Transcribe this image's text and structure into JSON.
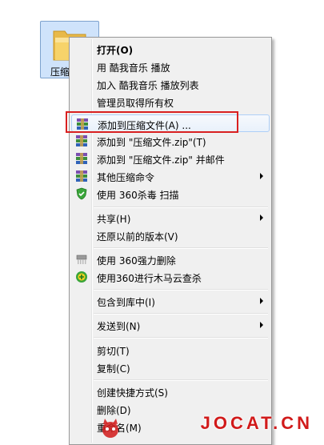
{
  "desktop": {
    "folder_label": "压缩"
  },
  "menu": {
    "items": [
      {
        "label": "打开(O)",
        "icon": "none"
      },
      {
        "label": "用 酷我音乐 播放",
        "icon": "none"
      },
      {
        "label": "加入 酷我音乐 播放列表",
        "icon": "none"
      },
      {
        "label": "管理员取得所有权",
        "icon": "none"
      },
      {
        "label": "添加到压缩文件(A) ...",
        "icon": "winrar-icon"
      },
      {
        "label": "添加到 \"压缩文件.zip\"(T)",
        "icon": "winrar-icon"
      },
      {
        "label": "添加到 \"压缩文件.zip\" 并邮件",
        "icon": "winrar-icon"
      },
      {
        "label": "其他压缩命令",
        "icon": "winrar-icon"
      },
      {
        "label": "使用 360杀毒 扫描",
        "icon": "360-shield-icon"
      },
      {
        "label": "共享(H)",
        "icon": "none"
      },
      {
        "label": "还原以前的版本(V)",
        "icon": "none"
      },
      {
        "label": "使用 360强力删除",
        "icon": "shredder-icon"
      },
      {
        "label": "使用360进行木马云查杀",
        "icon": "360-trojan-icon"
      },
      {
        "label": "包含到库中(I)",
        "icon": "none"
      },
      {
        "label": "发送到(N)",
        "icon": "none"
      },
      {
        "label": "剪切(T)",
        "icon": "none"
      },
      {
        "label": "复制(C)",
        "icon": "none"
      },
      {
        "label": "创建快捷方式(S)",
        "icon": "none"
      },
      {
        "label": "删除(D)",
        "icon": "none"
      },
      {
        "label": "重命名(M)",
        "icon": "none"
      }
    ]
  },
  "watermark": {
    "text": "JOCAT.CN"
  },
  "colors": {
    "highlight_border": "#aecff7",
    "annotation_red": "#d92020",
    "watermark_red": "#d11a1a"
  }
}
